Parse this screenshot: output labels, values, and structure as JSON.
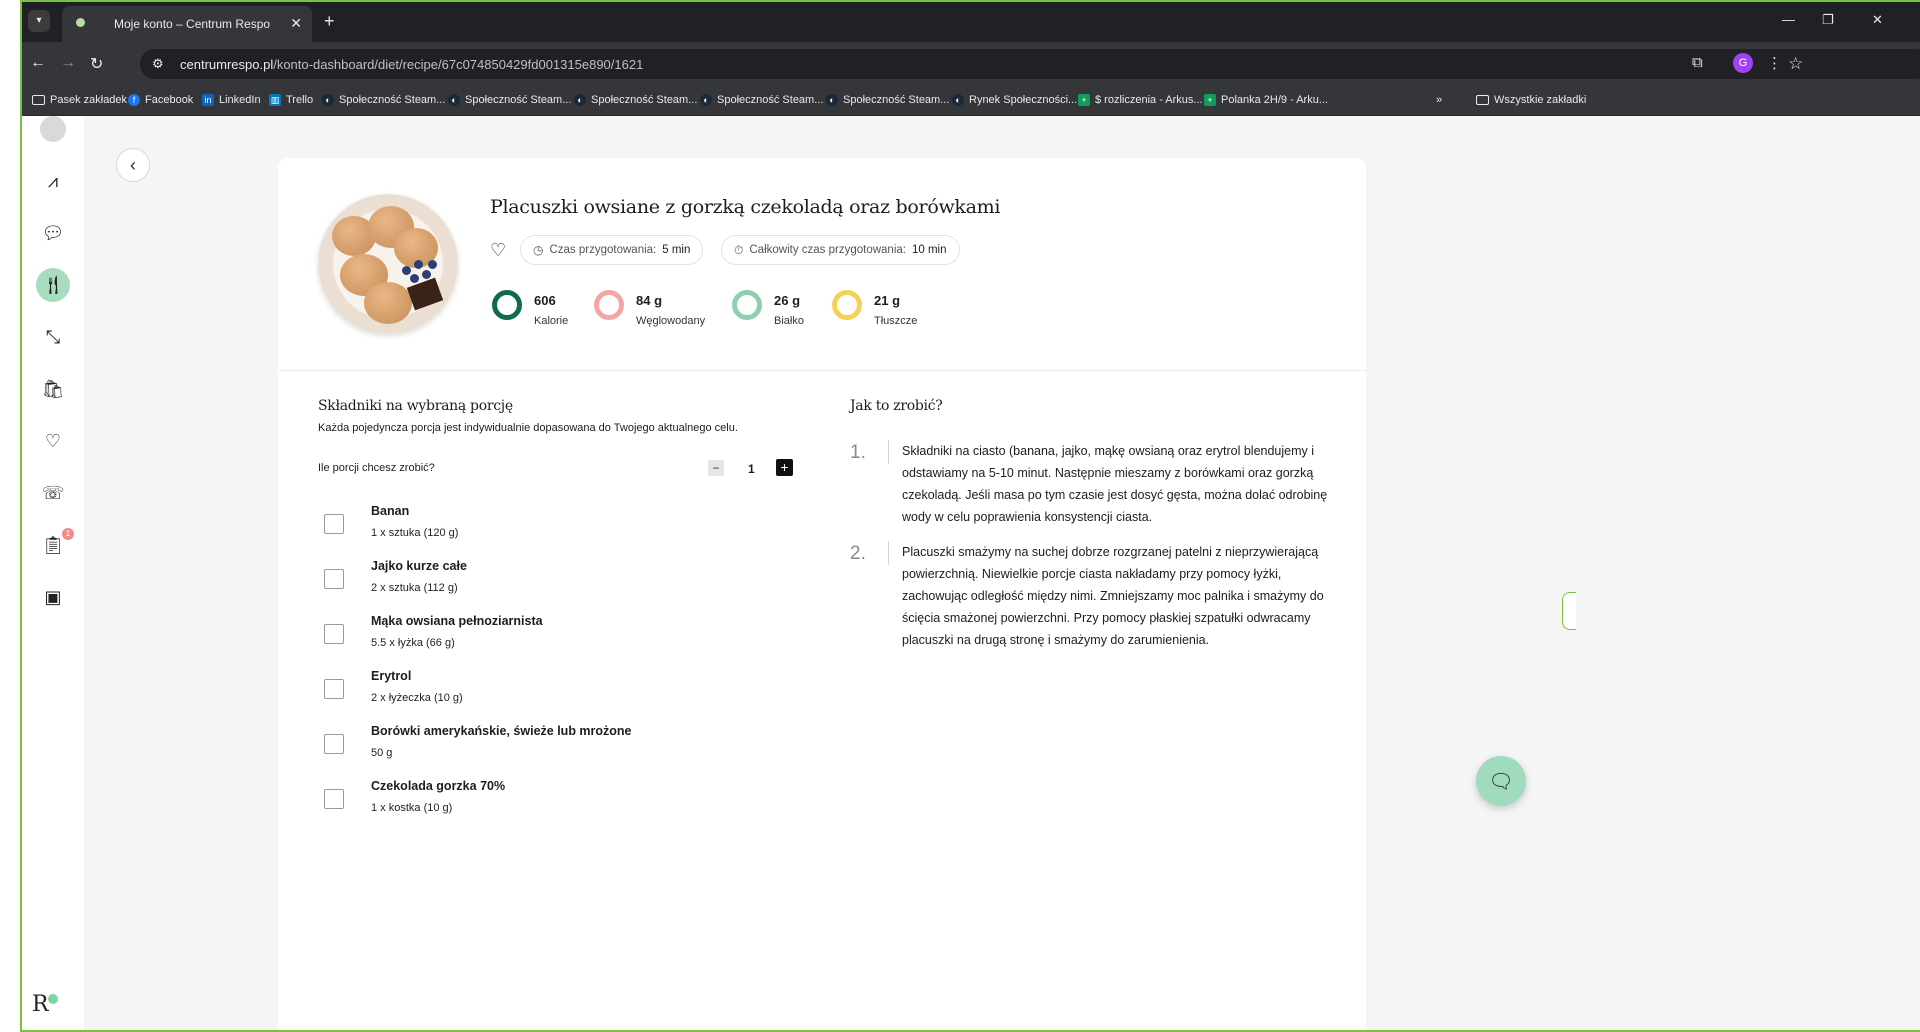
{
  "browser": {
    "tab_title": "Moje konto – Centrum Respo",
    "url_domain": "centrumrespo.pl",
    "url_path": "/konto-dashboard/diet/recipe/67c074850429fd001315e890/1621",
    "profile_initial": "G",
    "bookmarks": [
      {
        "label": "Pasek zakładek",
        "icon": "folder-icon"
      },
      {
        "label": "Facebook",
        "icon": "facebook-icon",
        "color": "#1877f2"
      },
      {
        "label": "LinkedIn",
        "icon": "linkedin-icon",
        "color": "#0a66c2"
      },
      {
        "label": "Trello",
        "icon": "trello-icon",
        "color": "#0079bf"
      },
      {
        "label": "Społeczność Steam...",
        "icon": "steam-icon"
      },
      {
        "label": "Społeczność Steam...",
        "icon": "steam-icon"
      },
      {
        "label": "Społeczność Steam...",
        "icon": "steam-icon"
      },
      {
        "label": "Społeczność Steam...",
        "icon": "steam-icon"
      },
      {
        "label": "Społeczność Steam...",
        "icon": "steam-icon"
      },
      {
        "label": "Rynek Społeczności...",
        "icon": "steam-icon"
      },
      {
        "label": "$ rozliczenia - Arkus...",
        "icon": "sheets-icon",
        "color": "#0f9d58"
      },
      {
        "label": "Polanka 2H/9 - Arku...",
        "icon": "sheets-icon",
        "color": "#0f9d58"
      }
    ],
    "all_bookmarks_label": "Wszystkie zakładki"
  },
  "sidebar": {
    "badge_count": "1",
    "brand": "R"
  },
  "recipe": {
    "title": "Placuszki owsiane z gorzką czekoladą oraz borówkami",
    "prep_time_label": "Czas przygotowania:",
    "prep_time_value": "5 min",
    "total_time_label": "Całkowity czas przygotowania:",
    "total_time_value": "10 min",
    "macros": [
      {
        "value": "606",
        "label": "Kalorie",
        "color": "#0d6b4f"
      },
      {
        "value": "84 g",
        "label": "Węglowodany",
        "color": "#f4a6a6"
      },
      {
        "value": "26 g",
        "label": "Białko",
        "color": "#8fcfb0"
      },
      {
        "value": "21 g",
        "label": "Tłuszcze",
        "color": "#f7d154"
      }
    ]
  },
  "ingredients": {
    "title": "Składniki na wybraną porcję",
    "subtitle": "Każda pojedyncza porcja jest indywidualnie dopasowana do Twojego aktualnego celu.",
    "portions_question": "Ile porcji chcesz zrobić?",
    "portions_value": "1",
    "minus": "−",
    "plus": "+",
    "items": [
      {
        "name": "Banan",
        "qty": "1 x sztuka (120 g)"
      },
      {
        "name": "Jajko kurze całe",
        "qty": "2 x sztuka (112 g)"
      },
      {
        "name": "Mąka owsiana pełnoziarnista",
        "qty": "5.5 x łyżka (66 g)"
      },
      {
        "name": "Erytrol",
        "qty": "2 x łyżeczka (10 g)"
      },
      {
        "name": "Borówki amerykańskie, świeże lub mrożone",
        "qty": "50 g"
      },
      {
        "name": "Czekolada gorzka 70%",
        "qty": "1 x kostka (10 g)"
      }
    ]
  },
  "instructions": {
    "title": "Jak to zrobić?",
    "steps": [
      {
        "num": "1.",
        "text": "Składniki na ciasto (banana, jajko, mąkę owsianą oraz erytrol blendujemy i odstawiamy na 5-10 minut. Następnie mieszamy z borówkami oraz gorzką czekoladą. Jeśli masa po tym czasie jest dosyć gęsta, można dolać odrobinę wody w celu poprawienia konsystencji ciasta."
      },
      {
        "num": "2.",
        "text": "Placuszki smażymy na suchej dobrze rozgrzanej patelni z nieprzywierającą powierzchnią. Niewielkie porcje ciasta nakładamy przy pomocy łyżki, zachowując odległość między nimi. Zmniejszamy moc palnika i smażymy do ścięcia smażonej powierzchni. Przy pomocy płaskiej szpatułki odwracamy placuszki na drugą stronę i smażymy do zarumienienia."
      }
    ]
  }
}
